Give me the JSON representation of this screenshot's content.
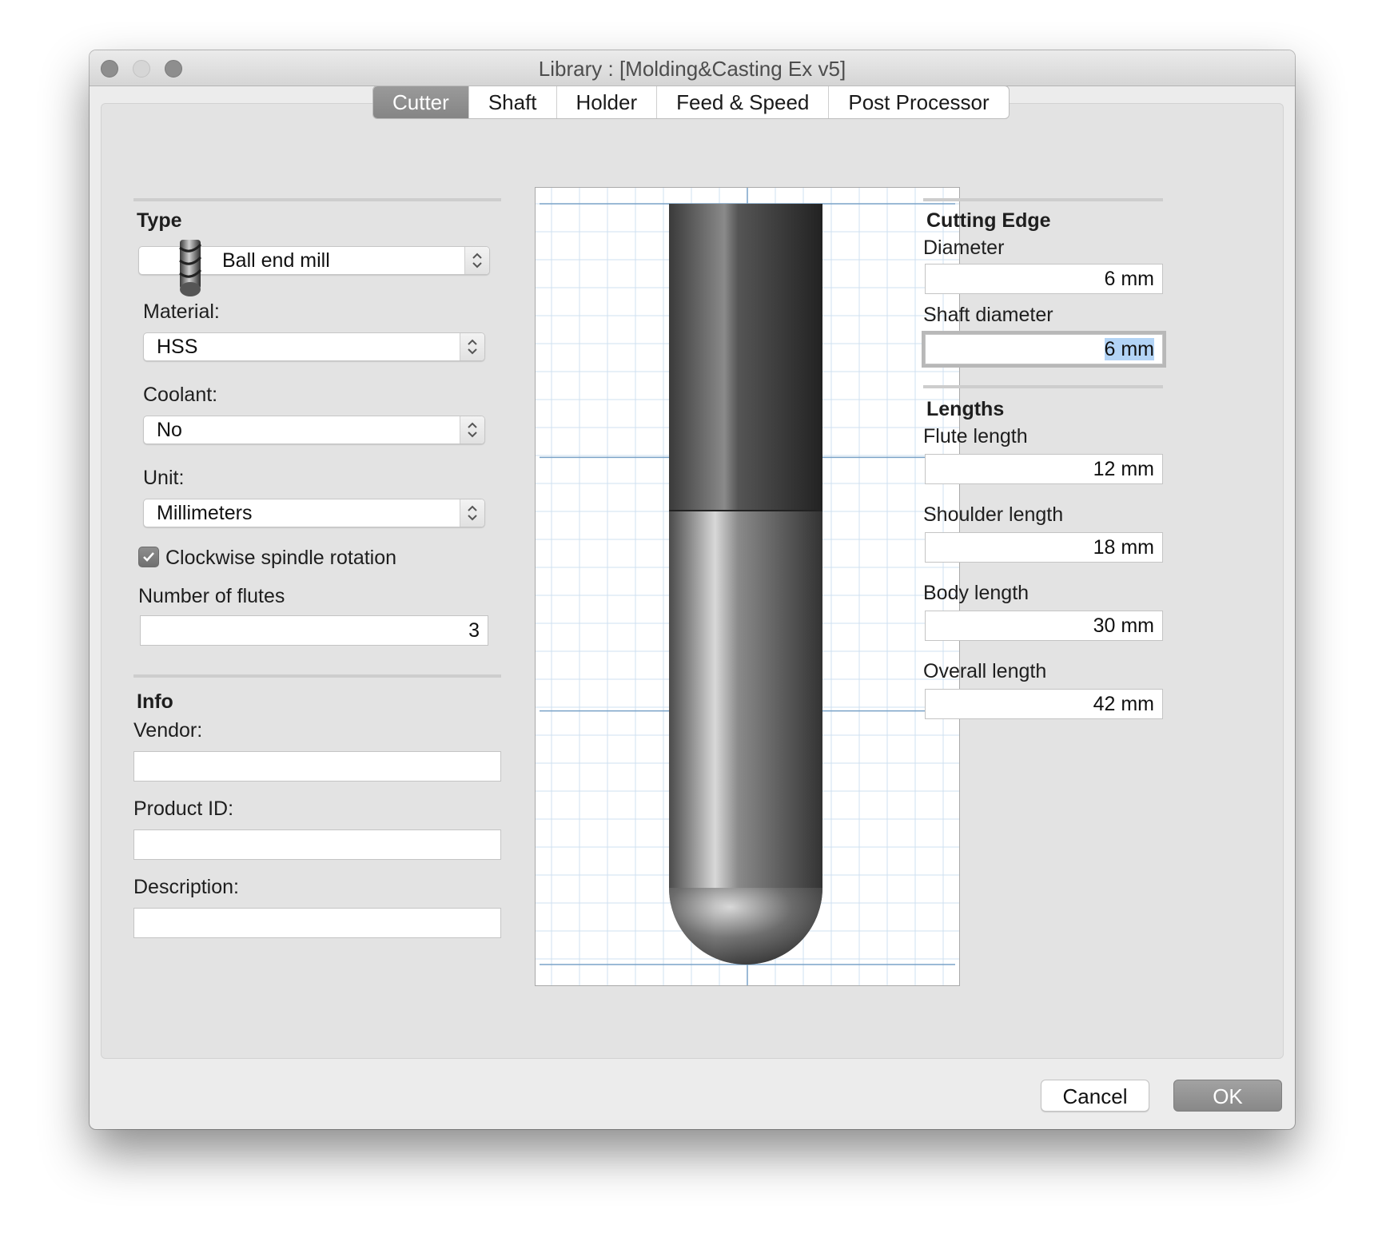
{
  "window": {
    "title": "Library :  [Molding&Casting Ex v5]"
  },
  "tabs": [
    {
      "label": "Cutter",
      "active": true
    },
    {
      "label": "Shaft",
      "active": false
    },
    {
      "label": "Holder",
      "active": false
    },
    {
      "label": "Feed & Speed",
      "active": false
    },
    {
      "label": "Post Processor",
      "active": false
    }
  ],
  "left": {
    "type_heading": "Type",
    "type_value": "Ball end mill",
    "material_label": "Material:",
    "material_value": "HSS",
    "coolant_label": "Coolant:",
    "coolant_value": "No",
    "unit_label": "Unit:",
    "unit_value": "Millimeters",
    "clockwise_label": "Clockwise spindle rotation",
    "clockwise_checked": true,
    "flutes_label": "Number of flutes",
    "flutes_value": "3",
    "info_heading": "Info",
    "vendor_label": "Vendor:",
    "vendor_value": "",
    "product_label": "Product ID:",
    "product_value": "",
    "description_label": "Description:",
    "description_value": ""
  },
  "right": {
    "cutting_heading": "Cutting Edge",
    "diameter_label": "Diameter",
    "diameter_value": "6 mm",
    "shaft_diameter_label": "Shaft diameter",
    "shaft_diameter_value": "6 mm",
    "lengths_heading": "Lengths",
    "flute_label": "Flute length",
    "flute_value": "12 mm",
    "shoulder_label": "Shoulder length",
    "shoulder_value": "18 mm",
    "body_label": "Body length",
    "body_value": "30 mm",
    "overall_label": "Overall length",
    "overall_value": "42 mm"
  },
  "buttons": {
    "cancel": "Cancel",
    "ok": "OK"
  },
  "colors": {
    "grid_minor": "#cfe0f0",
    "grid_major": "#7aa3c8",
    "accent_selection": "#b3d4f6"
  }
}
